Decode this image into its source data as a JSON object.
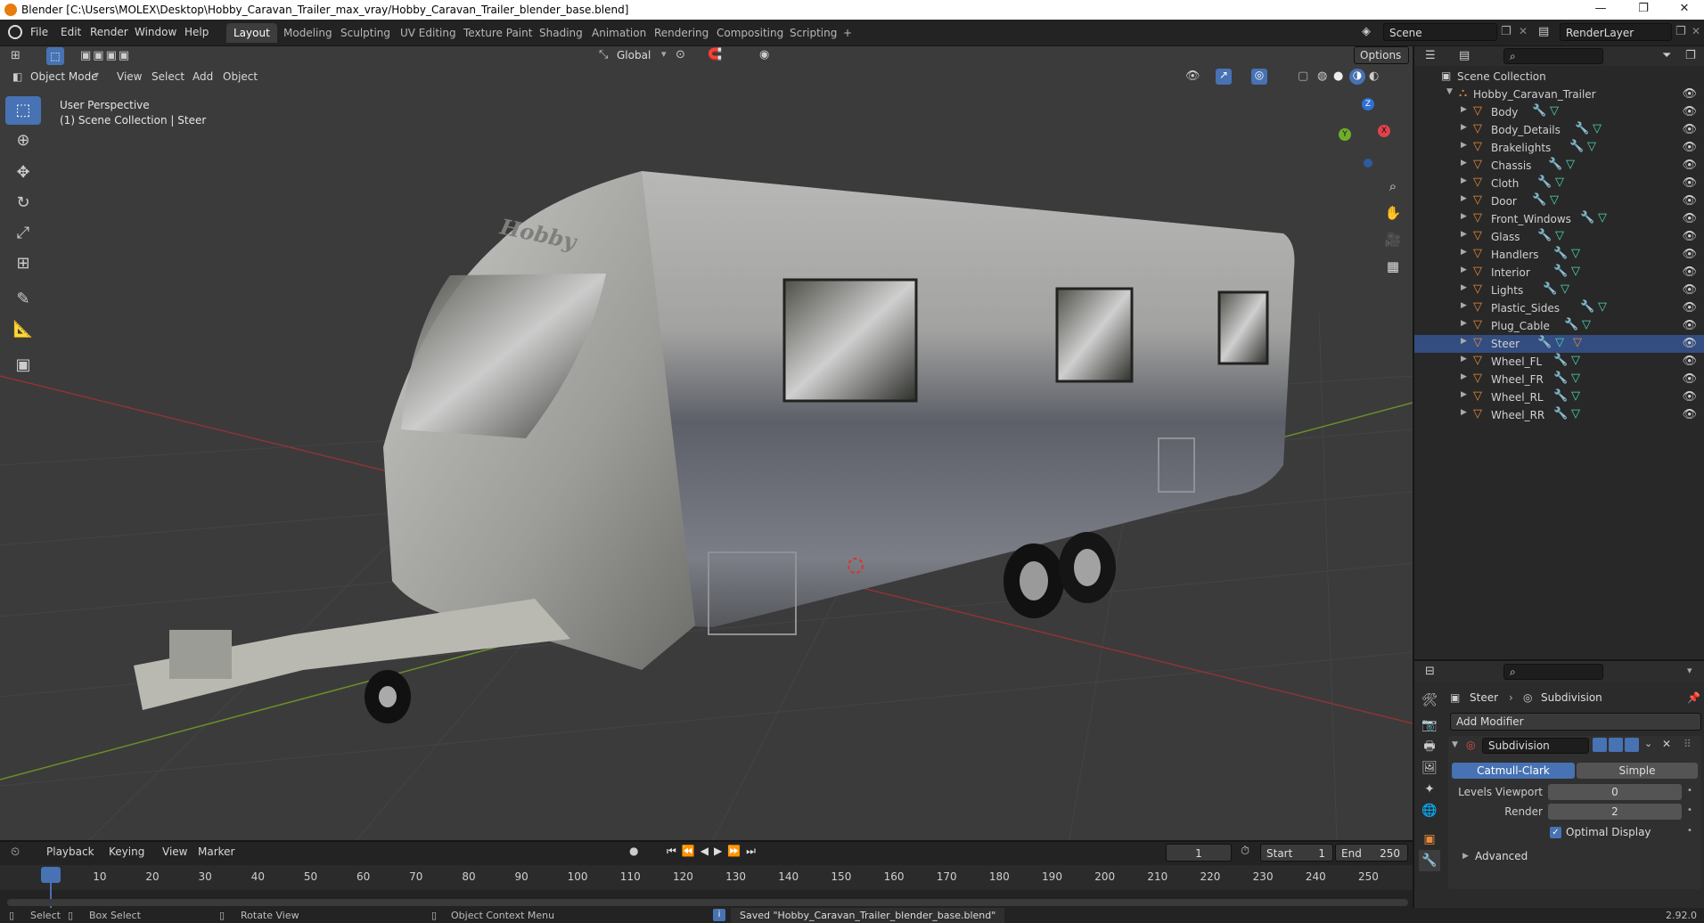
{
  "window": {
    "title": "Blender [C:\\Users\\MOLEX\\Desktop\\Hobby_Caravan_Trailer_max_vray/Hobby_Caravan_Trailer_blender_base.blend]",
    "minimize": "—",
    "maximize": "❐",
    "close": "✕"
  },
  "menubar": {
    "items": [
      "File",
      "Edit",
      "Render",
      "Window",
      "Help"
    ]
  },
  "workspaces": {
    "tabs": [
      "Layout",
      "Modeling",
      "Sculpting",
      "UV Editing",
      "Texture Paint",
      "Shading",
      "Animation",
      "Rendering",
      "Compositing",
      "Scripting"
    ],
    "active": "Layout",
    "add": "+"
  },
  "scene": {
    "name": "Scene",
    "view_layer": "RenderLayer"
  },
  "viewport_header": {
    "mode": "Object Mode",
    "menus": [
      "View",
      "Select",
      "Add",
      "Object"
    ],
    "transform_orientation": "Global",
    "options": "Options"
  },
  "viewport": {
    "perspective": "User Perspective",
    "collection_info": "(1) Scene Collection | Steer",
    "gizmo": {
      "z": "Z",
      "y": "Y",
      "x": "X"
    },
    "brand": "Hobby"
  },
  "outliner": {
    "root": "Scene Collection",
    "collection": "Hobby_Caravan_Trailer",
    "items": [
      {
        "label": "Body",
        "selected": false
      },
      {
        "label": "Body_Details",
        "selected": false
      },
      {
        "label": "Brakelights",
        "selected": false
      },
      {
        "label": "Chassis",
        "selected": false
      },
      {
        "label": "Cloth",
        "selected": false
      },
      {
        "label": "Door",
        "selected": false
      },
      {
        "label": "Front_Windows",
        "selected": false
      },
      {
        "label": "Glass",
        "selected": false
      },
      {
        "label": "Handlers",
        "selected": false
      },
      {
        "label": "Interior",
        "selected": false
      },
      {
        "label": "Lights",
        "selected": false
      },
      {
        "label": "Plastic_Sides",
        "selected": false
      },
      {
        "label": "Plug_Cable",
        "selected": false
      },
      {
        "label": "Steer",
        "selected": true
      },
      {
        "label": "Wheel_FL",
        "selected": false
      },
      {
        "label": "Wheel_FR",
        "selected": false
      },
      {
        "label": "Wheel_RL",
        "selected": false
      },
      {
        "label": "Wheel_RR",
        "selected": false
      }
    ]
  },
  "properties": {
    "object": "Steer",
    "modifier_context": "Subdivision",
    "add_modifier": "Add Modifier",
    "modifier_name": "Subdivision",
    "type_catmull": "Catmull-Clark",
    "type_simple": "Simple",
    "levels_viewport_label": "Levels Viewport",
    "levels_viewport": "0",
    "render_label": "Render",
    "render": "2",
    "optimal_display": "Optimal Display",
    "advanced": "Advanced"
  },
  "timeline": {
    "menus": [
      "Playback",
      "Keying",
      "View",
      "Marker"
    ],
    "current_frame": "1",
    "start_label": "Start",
    "start": "1",
    "end_label": "End",
    "end": "250",
    "ticks": [
      "1",
      "10",
      "20",
      "30",
      "40",
      "50",
      "60",
      "70",
      "80",
      "90",
      "100",
      "110",
      "120",
      "130",
      "140",
      "150",
      "160",
      "170",
      "180",
      "190",
      "200",
      "210",
      "220",
      "230",
      "240",
      "250"
    ]
  },
  "statusbar": {
    "select": "Select",
    "box_select": "Box Select",
    "rotate_view": "Rotate View",
    "context_menu": "Object Context Menu",
    "message": "Saved \"Hobby_Caravan_Trailer_blender_base.blend\"",
    "version": "2.92.0"
  },
  "colors": {
    "accent": "#4772b3",
    "selection": "#334d80",
    "object_orange": "#e78a38",
    "modifier_blue": "#5c8fd6",
    "mesh_green": "#4fd7b5"
  }
}
